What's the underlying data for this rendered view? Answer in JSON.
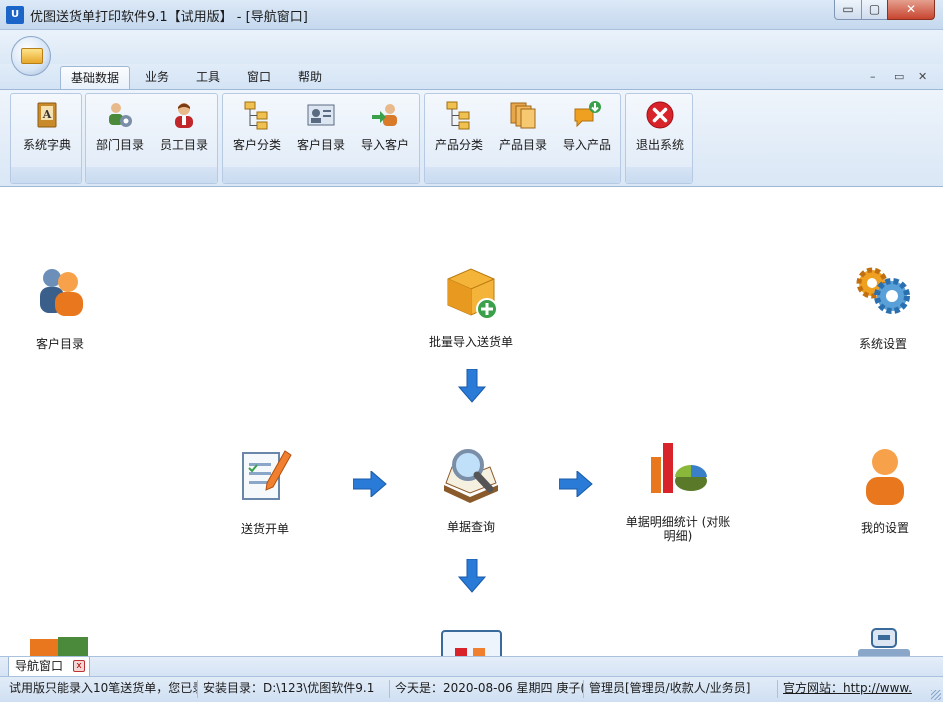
{
  "window": {
    "icon_text": "U",
    "title": "优图送货单打印软件9.1【试用版】 - [导航窗口]",
    "min": "▭",
    "max": "▢",
    "close": "✕"
  },
  "tabs": [
    {
      "label": "基础数据",
      "active": true
    },
    {
      "label": "业务"
    },
    {
      "label": "工具"
    },
    {
      "label": "窗口"
    },
    {
      "label": "帮助"
    }
  ],
  "mdi": {
    "min": "–",
    "restore": "▭",
    "close": "✕"
  },
  "ribbon": {
    "system_dict": {
      "label": "系统字典",
      "icon": "dictionary-book-icon"
    },
    "dept_list": {
      "label": "部门目录",
      "icon": "department-users-icon"
    },
    "staff_list": {
      "label": "员工目录",
      "icon": "employee-icon"
    },
    "customer_category": {
      "label": "客户分类",
      "icon": "tree-category-icon"
    },
    "customer_list": {
      "label": "客户目录",
      "icon": "contact-card-icon"
    },
    "import_customer": {
      "label": "导入客户",
      "icon": "import-user-icon"
    },
    "product_category": {
      "label": "产品分类",
      "icon": "tree-category-icon"
    },
    "product_list": {
      "label": "产品目录",
      "icon": "product-folders-icon"
    },
    "import_product": {
      "label": "导入产品",
      "icon": "import-product-icon"
    },
    "exit_system": {
      "label": "退出系统",
      "icon": "exit-x-icon"
    }
  },
  "nav": {
    "customer_list": "客户目录",
    "batch_import": "批量导入送货单",
    "system_settings": "系统设置",
    "delivery_order": "送货开单",
    "order_query": "单据查询",
    "detail_stats_line1": "单据明细统计 (对账",
    "detail_stats_line2": "明细)",
    "my_settings": "我的设置"
  },
  "doc_tab": {
    "label": "导航窗口",
    "close": "x"
  },
  "status": {
    "trial": "试用版只能录入10笔送货单，您已录",
    "install_dir": "安装目录：D:\\123\\优图软件9.1",
    "today": "今天是：2020-08-06 星期四 庚子(",
    "user": "管理员[管理员/收款人/业务员]",
    "site": "官方网站：http://www."
  },
  "colors": {
    "ribbon_bg": "#dae7f6",
    "accent_blue": "#1b64c8",
    "close_red": "#c74530"
  }
}
